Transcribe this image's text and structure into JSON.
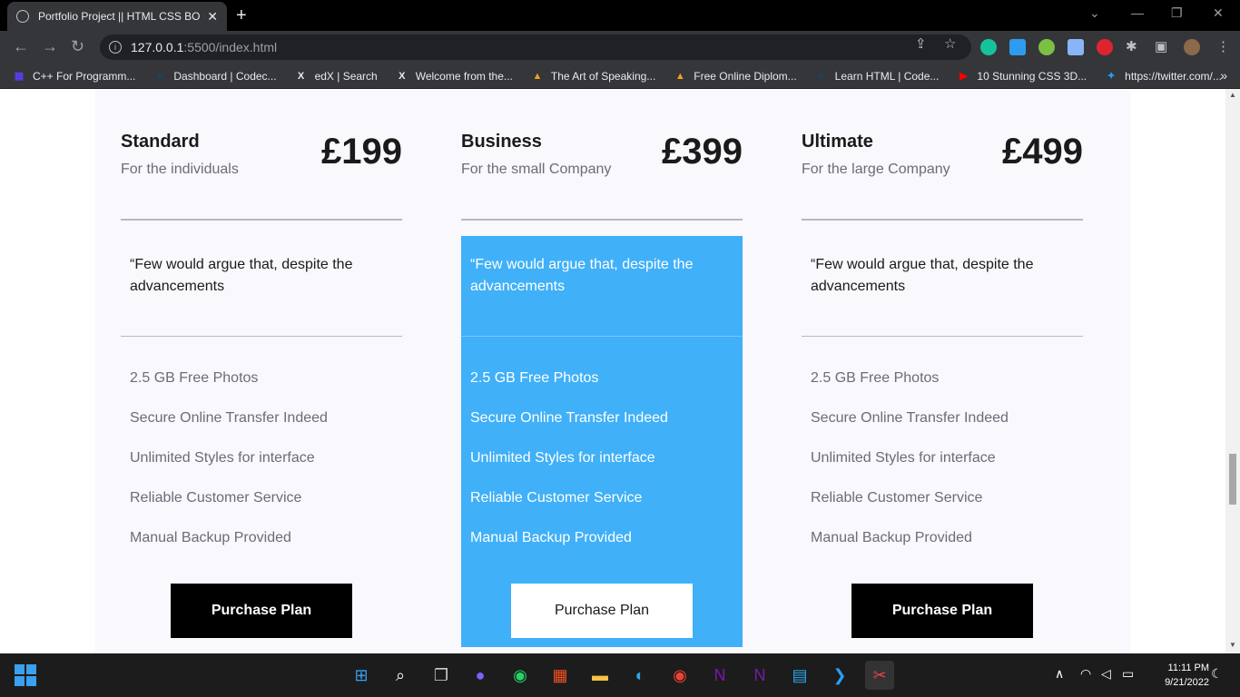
{
  "browser": {
    "tab_title": "Portfolio Project || HTML CSS BOO",
    "url_host": "127.0.0.1",
    "url_path": ":5500/index.html",
    "bookmarks": [
      {
        "label": "C++ For Programm...",
        "icon": "book-icon",
        "color": "#5b3ef0"
      },
      {
        "label": "Dashboard | Codec...",
        "icon": "codecademy-icon",
        "color": "#1f4056"
      },
      {
        "label": "edX | Search",
        "icon": "edx-icon",
        "color": "#ffffff"
      },
      {
        "label": "Welcome from the...",
        "icon": "edx-icon",
        "color": "#ffffff"
      },
      {
        "label": "The Art of Speaking...",
        "icon": "alison-icon",
        "color": "#f0a020"
      },
      {
        "label": "Free Online Diplom...",
        "icon": "alison-icon",
        "color": "#f0a020"
      },
      {
        "label": "Learn HTML | Code...",
        "icon": "codecademy-icon",
        "color": "#1f4056"
      },
      {
        "label": "10 Stunning CSS 3D...",
        "icon": "youtube-icon",
        "color": "#ff0000"
      },
      {
        "label": "https://twitter.com/...",
        "icon": "twitter-icon",
        "color": "#1da1f2"
      }
    ]
  },
  "pricing": {
    "plans": [
      {
        "name": "Standard",
        "subtitle": "For the individuals",
        "price": "£199",
        "quote": "“Few would argue that, despite the advancements",
        "features": [
          "2.5 GB Free Photos",
          "Secure Online Transfer Indeed",
          "Unlimited Styles for interface",
          "Reliable Customer Service",
          "Manual Backup Provided"
        ],
        "button": "Purchase Plan"
      },
      {
        "name": "Business",
        "subtitle": "For the small Company",
        "price": "£399",
        "quote": "“Few would argue that, despite the advancements",
        "features": [
          "2.5 GB Free Photos",
          "Secure Online Transfer Indeed",
          "Unlimited Styles for interface",
          "Reliable Customer Service",
          "Manual Backup Provided"
        ],
        "button": "Purchase Plan"
      },
      {
        "name": "Ultimate",
        "subtitle": "For the large Company",
        "price": "£499",
        "quote": "“Few would argue that, despite the advancements",
        "features": [
          "2.5 GB Free Photos",
          "Secure Online Transfer Indeed",
          "Unlimited Styles for interface",
          "Reliable Customer Service",
          "Manual Backup Provided"
        ],
        "button": "Purchase Plan"
      }
    ],
    "accent_color": "#40b0f8"
  },
  "taskbar": {
    "time": "11:11 PM",
    "date": "9/21/2022"
  }
}
